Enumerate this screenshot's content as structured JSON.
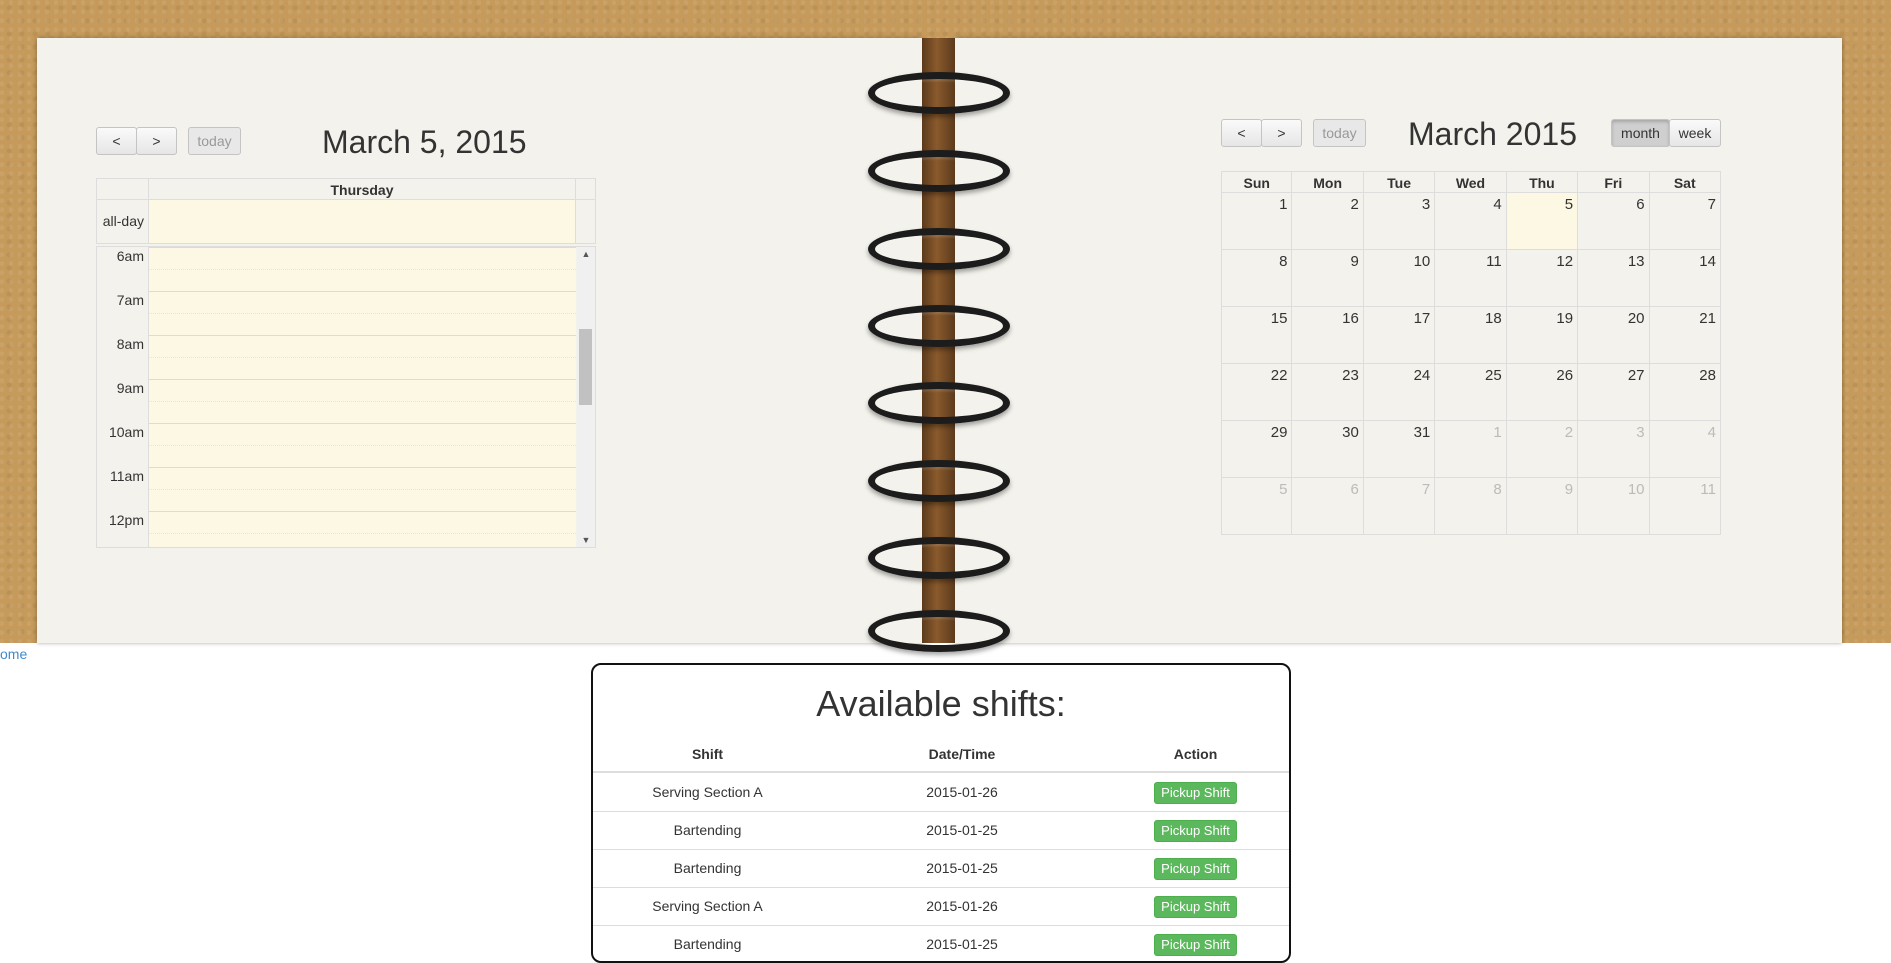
{
  "day_view": {
    "prev_label": "<",
    "next_label": ">",
    "today_label": "today",
    "title": "March 5, 2015",
    "day_name": "Thursday",
    "allday_label": "all-day",
    "times": [
      "6am",
      "7am",
      "8am",
      "9am",
      "10am",
      "11am",
      "12pm"
    ]
  },
  "month_view": {
    "prev_label": "<",
    "next_label": ">",
    "today_label": "today",
    "title": "March 2015",
    "month_label": "month",
    "week_label": "week",
    "weekdays": [
      "Sun",
      "Mon",
      "Tue",
      "Wed",
      "Thu",
      "Fri",
      "Sat"
    ],
    "weeks": [
      [
        "1",
        "2",
        "3",
        "4",
        "5",
        "6",
        "7"
      ],
      [
        "8",
        "9",
        "10",
        "11",
        "12",
        "13",
        "14"
      ],
      [
        "15",
        "16",
        "17",
        "18",
        "19",
        "20",
        "21"
      ],
      [
        "22",
        "23",
        "24",
        "25",
        "26",
        "27",
        "28"
      ],
      [
        "29",
        "30",
        "31",
        "1",
        "2",
        "3",
        "4"
      ],
      [
        "5",
        "6",
        "7",
        "8",
        "9",
        "10",
        "11"
      ]
    ]
  },
  "home_link": "ome",
  "shifts": {
    "title": "Available shifts:",
    "headers": [
      "Shift",
      "Date/Time",
      "Action"
    ],
    "rows": [
      {
        "shift": "Serving Section A",
        "date": "2015-01-26",
        "action": "Pickup Shift"
      },
      {
        "shift": "Bartending",
        "date": "2015-01-25",
        "action": "Pickup Shift"
      },
      {
        "shift": "Bartending",
        "date": "2015-01-25",
        "action": "Pickup Shift"
      },
      {
        "shift": "Serving Section A",
        "date": "2015-01-26",
        "action": "Pickup Shift"
      },
      {
        "shift": "Bartending",
        "date": "2015-01-25",
        "action": "Pickup Shift"
      }
    ]
  }
}
